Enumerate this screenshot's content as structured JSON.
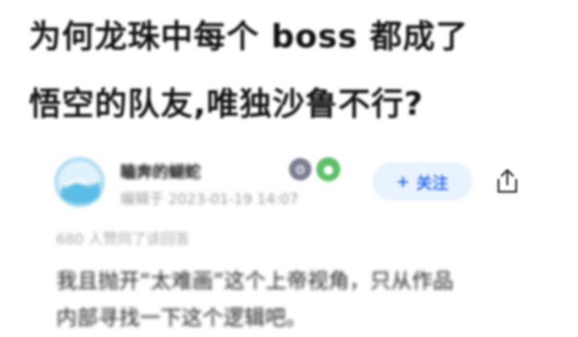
{
  "question": {
    "title_line1": "为何龙珠中每个 boss 都成了",
    "title_line2": "悟空的队友,唯独沙鲁不行?"
  },
  "answer": {
    "author_name": "瞌奔的蝴蛇",
    "edited_time": "编辑于 2023-01-19 14:07",
    "follow_label": "关注",
    "follow_plus": "+",
    "likes_text": "680 人赞同了该回答",
    "body_line1": "我且抛开“太难画”这个上帝视角，只从作品",
    "body_line2": "内部寻找一下这个逻辑吧。"
  },
  "colors": {
    "accent": "#2f6ce6",
    "follow_bg": "#e9f2ff",
    "badge_green": "#5fbf68",
    "badge_gray": "#7c7f93"
  },
  "icons": {
    "share": "share-icon",
    "avatar": "avatar-image",
    "badge1": "gear-badge-icon",
    "badge2": "green-badge-icon"
  }
}
